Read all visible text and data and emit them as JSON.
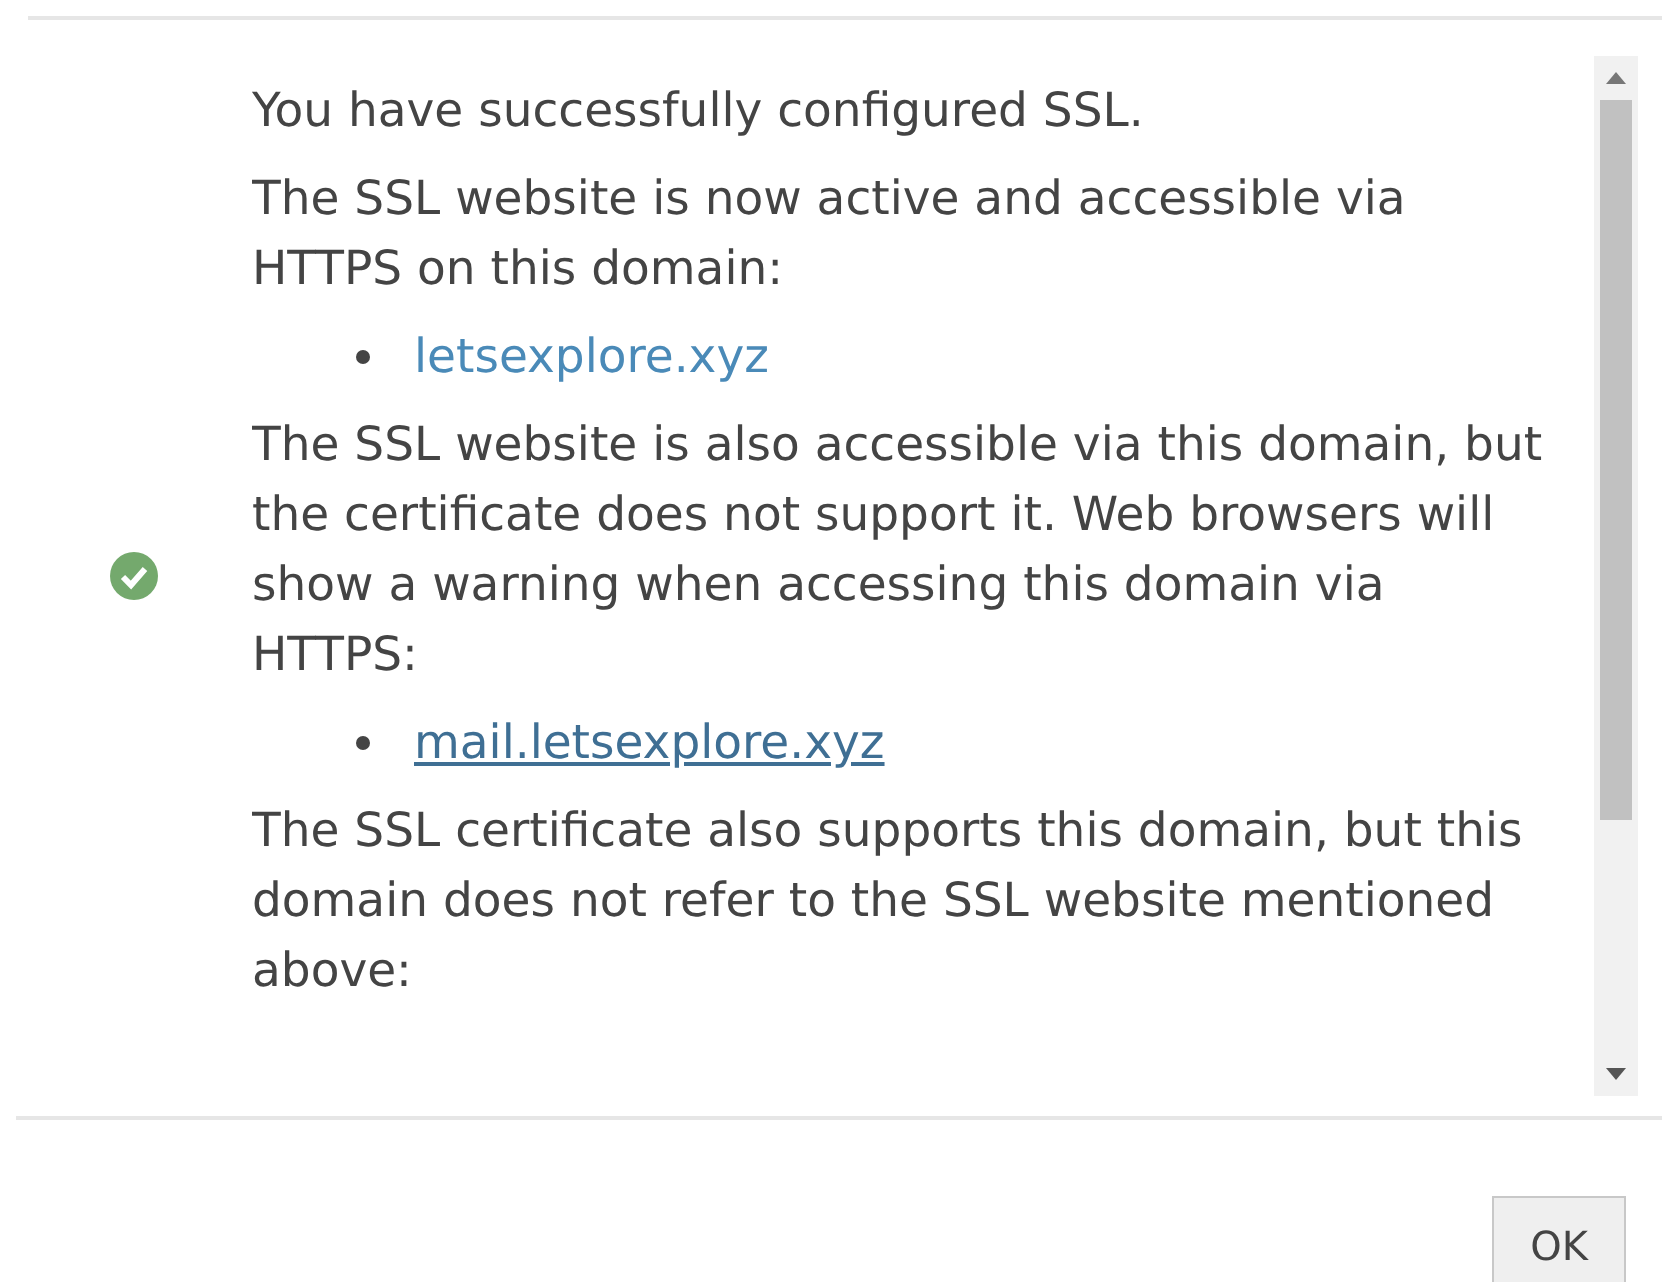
{
  "message": {
    "blocks": [
      {
        "kind": "paragraph",
        "text": "You have successfully configured SSL."
      },
      {
        "kind": "paragraph",
        "text": "The SSL website is now active and accessible via HTTPS on this domain:"
      },
      {
        "kind": "list",
        "items": [
          {
            "text": "letsexplore.xyz",
            "underlined": false
          }
        ]
      },
      {
        "kind": "paragraph",
        "text": "The SSL website is also accessible via this domain, but the certificate does not support it. Web browsers will show a warning when accessing this domain via HTTPS:"
      },
      {
        "kind": "list",
        "items": [
          {
            "text": "mail.letsexplore.xyz",
            "underlined": true
          }
        ]
      },
      {
        "kind": "paragraph",
        "text": "The SSL certificate also supports this domain, but this domain does not refer to the SSL website mentioned above:"
      }
    ]
  },
  "buttons": [
    {
      "label": "OK"
    }
  ]
}
